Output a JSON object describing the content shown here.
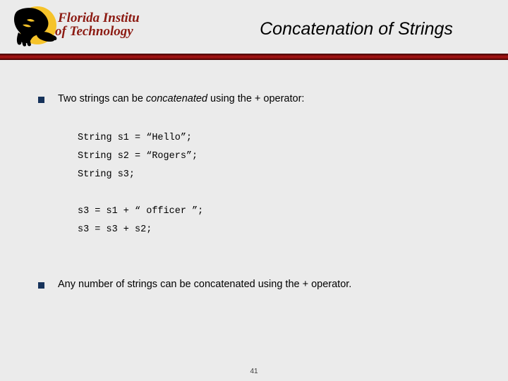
{
  "slide": {
    "title": "Concatenation of Strings",
    "page_number": "41",
    "background_color": "#ebebeb",
    "divider_color": "#a81414",
    "bullet_color": "#16325a"
  },
  "logo": {
    "name": "florida-institute-of-technology-logo",
    "line1": "Florida Institute",
    "line2": "of Technology",
    "text_color": "#8c1a12",
    "circle_color": "#f6c32a",
    "panther_color": "#000000"
  },
  "bullets": [
    {
      "pre": "Two strings can be ",
      "emphasis": "concatenated",
      "post": " using the + operator:"
    },
    {
      "pre": "Any number of strings can be concatenated using the + operator.",
      "emphasis": "",
      "post": ""
    }
  ],
  "code": {
    "lines": [
      "String s1 = “Hello”;",
      "String s2 = “Rogers”;",
      "String s3;",
      "",
      "s3 = s1 + “ officer ”;",
      "s3 = s3 + s2;"
    ]
  }
}
